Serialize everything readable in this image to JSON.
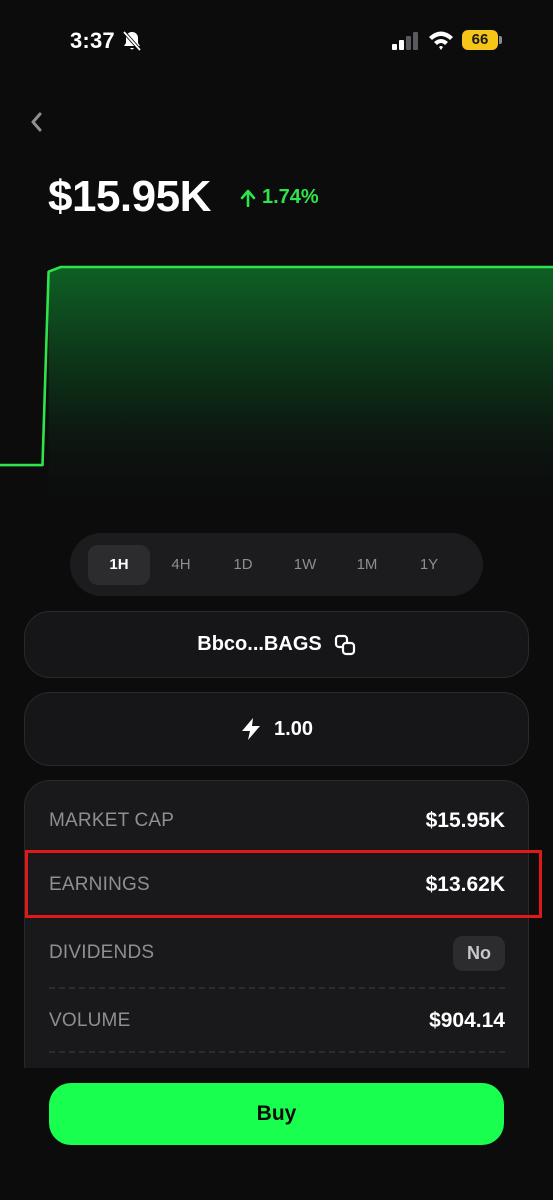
{
  "status_bar": {
    "time": "3:37",
    "battery": "66",
    "battery_color": "#f5c518"
  },
  "header": {
    "back_icon": "chevron-left-icon",
    "price": "$15.95K",
    "change_icon": "arrow-up-icon",
    "change": "1.74%",
    "change_color": "#2fe34a"
  },
  "chart_data": {
    "type": "area",
    "title": "",
    "xlabel": "",
    "ylabel": "",
    "grid": false,
    "line_color": "#2fe34a",
    "series": [
      {
        "values": [
          0.15,
          0.15,
          0.15,
          0.15,
          0.15,
          0.15,
          0.15,
          0.15,
          0.98,
          0.99,
          1,
          1,
          1,
          1,
          1,
          1,
          1,
          1,
          1,
          1,
          1,
          1,
          1,
          1,
          1,
          1,
          1,
          1,
          1,
          1,
          1,
          1,
          1,
          1,
          1,
          1,
          1,
          1,
          1,
          1,
          1,
          1,
          1,
          1,
          1,
          1,
          1,
          1,
          1,
          1,
          1,
          1,
          1,
          1,
          1,
          1,
          1,
          1,
          1,
          1,
          1,
          1,
          1,
          1,
          1,
          1,
          1,
          1,
          1,
          1,
          1,
          1,
          1,
          1,
          1,
          1,
          1,
          1,
          1,
          1,
          1,
          1,
          1,
          1,
          1,
          1,
          1,
          1,
          1,
          1,
          1,
          1
        ]
      }
    ]
  },
  "timeframes": {
    "options": [
      "1H",
      "4H",
      "1D",
      "1W",
      "1M",
      "1Y"
    ],
    "selected": "1H"
  },
  "contract": {
    "label": "Bbco...BAGS",
    "copy_icon": "copy-icon"
  },
  "multiplier": {
    "icon": "lightning-icon",
    "value": "1.00"
  },
  "stats": {
    "market_cap_label": "MARKET CAP",
    "market_cap_value": "$15.95K",
    "earnings_label": "EARNINGS",
    "earnings_value": "$13.62K",
    "dividends_label": "DIVIDENDS",
    "dividends_value": "No",
    "volume_label": "VOLUME",
    "volume_value": "$904.14"
  },
  "buy": {
    "label": "Buy",
    "color": "#19ff4f"
  }
}
